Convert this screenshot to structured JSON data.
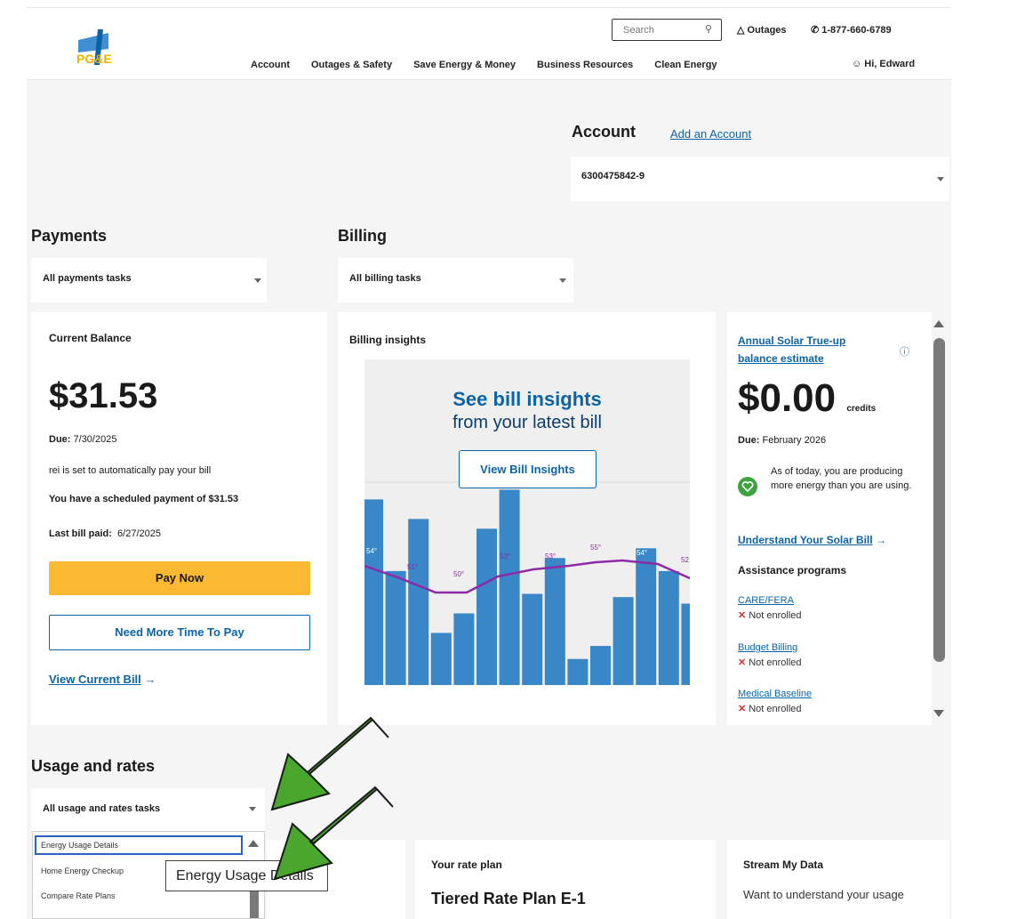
{
  "header": {
    "search_placeholder": "Search",
    "outages": "Outages",
    "phone": "1-877-660-6789",
    "greeting": "Hi, Edward",
    "nav": [
      "Account",
      "Outages & Safety",
      "Save Energy & Money",
      "Business Resources",
      "Clean Energy"
    ]
  },
  "account": {
    "title": "Account",
    "add_link": "Add an Account",
    "number": "6300475842-9"
  },
  "payments": {
    "title": "Payments",
    "dropdown": "All payments tasks"
  },
  "billing": {
    "title": "Billing",
    "dropdown": "All billing tasks"
  },
  "balance_card": {
    "title": "Current Balance",
    "amount": "$31.53",
    "due_label": "Due:",
    "due_date": "7/30/2025",
    "autopay": "rei is set to automatically pay your bill",
    "scheduled": "You have a scheduled payment of $31.53",
    "last_paid_label": "Last bill paid:",
    "last_paid_date": "6/27/2025",
    "pay_now": "Pay Now",
    "more_time": "Need More Time To Pay",
    "view_bill": "View Current Bill"
  },
  "insights_card": {
    "title": "Billing insights",
    "headline": "See bill insights",
    "subline": "from your latest bill",
    "button": "View Bill Insights",
    "temp_labels": [
      "54°",
      "51°",
      "50°",
      "53°",
      "53°",
      "55°",
      "54°",
      "52"
    ],
    "bar_levels": [
      0.57,
      0.35,
      0.51,
      0.16,
      0.22,
      0.48,
      0.6,
      0.28,
      0.39,
      0.08,
      0.12,
      0.27,
      0.42,
      0.35,
      0.25
    ]
  },
  "solar_card": {
    "title": "Annual Solar True-up balance estimate",
    "amount": "$0.00",
    "credits": "credits",
    "due_label": "Due:",
    "due_date": "February 2026",
    "status": "As of today, you are producing more energy than you are using.",
    "understand": "Understand Your Solar Bill",
    "assistance": "Assistance programs",
    "programs": [
      {
        "name": "CARE/FERA",
        "status": "Not enrolled"
      },
      {
        "name": "Budget Billing",
        "status": "Not enrolled"
      },
      {
        "name": "Medical Baseline",
        "status": "Not enrolled"
      }
    ]
  },
  "usage": {
    "title": "Usage and rates",
    "dropdown": "All usage and rates tasks",
    "options": [
      "Energy Usage Details",
      "Home Energy Checkup",
      "Compare Rate Plans"
    ],
    "tooltip": "Energy Usage Details"
  },
  "rate_card": {
    "label": "Your rate plan",
    "plan": "Tiered Rate Plan E-1"
  },
  "stream_card": {
    "title": "Stream My Data",
    "text": "Want to understand your usage"
  },
  "colors": {
    "brand_blue": "#0c64a7",
    "pay_yellow": "#fbb833",
    "bar_blue": "#3a87c8",
    "temp_line": "#8e2aa8",
    "annotation_arrow": "#4aa62d"
  }
}
